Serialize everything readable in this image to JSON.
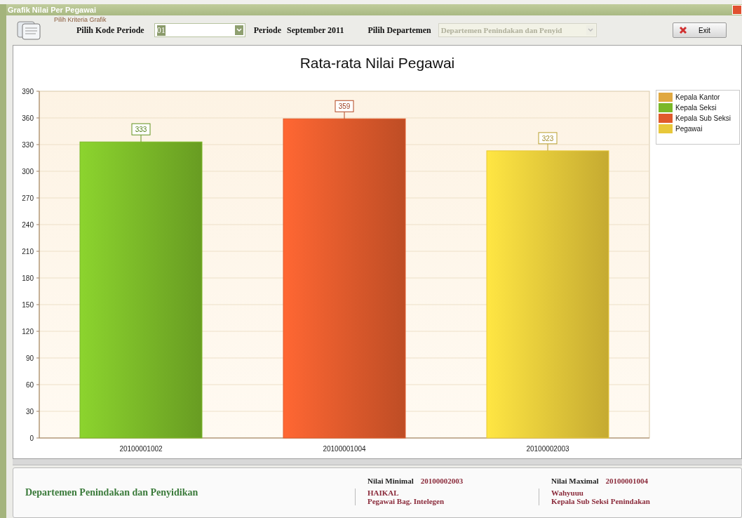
{
  "window": {
    "title": "Grafik Nilai Per Pegawai"
  },
  "toolbar": {
    "group_label": "Pilih Kriteria Grafik",
    "period_code": {
      "label": "Pilih Kode Periode",
      "value": "01"
    },
    "period": {
      "label": "Periode",
      "value": "September 2011"
    },
    "department": {
      "label": "Pilih Departemen",
      "value": "Departemen Penindakan dan Penyid",
      "disabled": true
    },
    "exit_button": {
      "label": "Exit"
    }
  },
  "chart": {
    "title": "Rata-rata Nilai Pegawai",
    "chart_data": {
      "type": "bar",
      "categories": [
        "20100001002",
        "20100001004",
        "20100002003"
      ],
      "series": [
        {
          "name": "Kepala Kantor",
          "color": "#e0a840",
          "values": [
            null,
            null,
            null
          ]
        },
        {
          "name": "Kepala Seksi",
          "color": "#7ab828",
          "values": [
            333,
            null,
            null
          ]
        },
        {
          "name": "Kepala Sub Seksi",
          "color": "#e05a2c",
          "values": [
            null,
            359,
            null
          ]
        },
        {
          "name": "Pegawai",
          "color": "#e8c83a",
          "values": [
            null,
            null,
            323
          ]
        }
      ],
      "ylim": [
        0,
        390
      ],
      "yticks": [
        0,
        30,
        60,
        90,
        120,
        150,
        180,
        210,
        240,
        270,
        300,
        330,
        360,
        390
      ],
      "data_labels": true,
      "grid": true
    }
  },
  "summary": {
    "department": "Departemen Penindakan dan Penyidikan",
    "minimum": {
      "label": "Nilai Minimal",
      "code": "20100002003",
      "name": "HAIKAL",
      "position": "Pegawai Bag. Intelegen"
    },
    "maximum": {
      "label": "Nilai Maximal",
      "code": "20100001004",
      "name": "Wahyuuu",
      "position": "Kepala Sub Seksi Penindakan"
    }
  }
}
